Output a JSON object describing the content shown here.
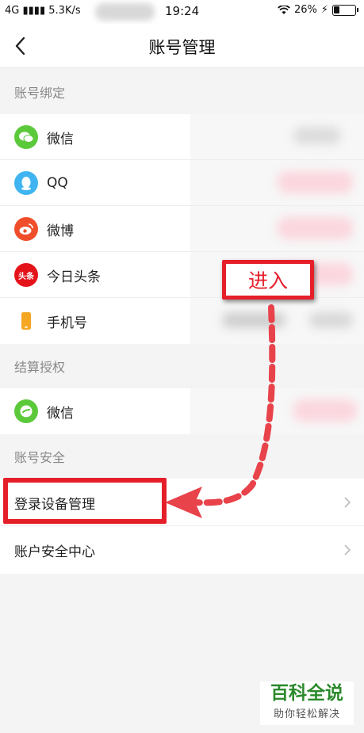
{
  "status_bar": {
    "network": "4G",
    "speed": "5.3K/s",
    "time": "19:24",
    "battery": "26%",
    "battery_level": 0.26
  },
  "nav": {
    "title": "账号管理",
    "back_icon": "chevron-left-icon"
  },
  "sections": {
    "binding": {
      "title": "账号绑定",
      "items": [
        {
          "label": "微信",
          "icon": "wechat-icon",
          "color": "#5cc93b"
        },
        {
          "label": "QQ",
          "icon": "qq-icon",
          "color": "#3fb4f0"
        },
        {
          "label": "微博",
          "icon": "weibo-icon",
          "color": "#f04e2b"
        },
        {
          "label": "今日头条",
          "icon": "toutiao-icon",
          "color": "#e4131a",
          "icon_text": "头条"
        },
        {
          "label": "手机号",
          "icon": "phone-icon",
          "color": "#f5a623"
        }
      ]
    },
    "settlement": {
      "title": "结算授权",
      "items": [
        {
          "label": "微信",
          "icon": "wechat-pay-icon",
          "color": "#5cc93b"
        }
      ]
    },
    "security": {
      "title": "账号安全",
      "items": [
        {
          "label": "登录设备管理",
          "icon": "chevron-right-icon"
        },
        {
          "label": "账户安全中心",
          "icon": "chevron-right-icon"
        }
      ]
    }
  },
  "annotation": {
    "callout_text": "进入",
    "accent_color": "#e51f2a"
  },
  "watermark": {
    "title": "百科全说",
    "subtitle": "助你轻松解决"
  }
}
